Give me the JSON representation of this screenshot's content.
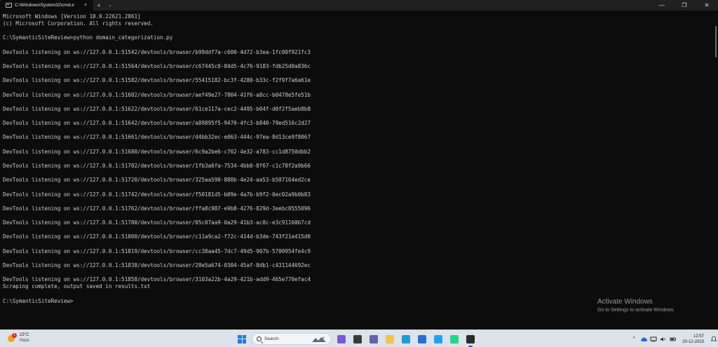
{
  "window": {
    "tab_title": "C:\\Windows\\System32\\cmd.e",
    "tab_close": "×",
    "new_tab": "+",
    "tab_menu": "⌄",
    "minimize": "—",
    "maximize": "❐",
    "close": "✕"
  },
  "console": {
    "lines": [
      "Microsoft Windows [Version 10.0.22621.2861]",
      "(c) Microsoft Corporation. All rights reserved.",
      "",
      "C:\\SymanticSiteReview>python domain_categorization.py",
      "",
      "DevTools listening on ws://127.0.0.1:51542/devtools/browser/b99ddf7a-c600-4d72-b3ea-1fc00f921fc3",
      "",
      "DevTools listening on ws://127.0.0.1:51564/devtools/browser/c67445c0-84d5-4c76-9183-fdb25d0a836c",
      "",
      "DevTools listening on ws://127.0.0.1:51582/devtools/browser/55415182-bc3f-4280-b33c-f2f9f7a6a61e",
      "",
      "DevTools listening on ws://127.0.0.1:51602/devtools/browser/aef49e27-7804-41f6-a8cc-b0478e5fe51b",
      "",
      "DevTools listening on ws://127.0.0.1:51622/devtools/browser/61ce117a-cec2-4495-b04f-d0f2f5aeb8b8",
      "",
      "DevTools listening on ws://127.0.0.1:51642/devtools/browser/a89895f5-9470-4fc3-b840-79ed516c2d27",
      "",
      "DevTools listening on ws://127.0.0.1:51661/devtools/browser/d4bb32ec-e063-444c-97ea-8d13ce9f8067",
      "",
      "DevTools listening on ws://127.0.0.1:51680/devtools/browser/6c9a2be6-c702-4e32-a783-cc1d8750dbb2",
      "",
      "DevTools listening on ws://127.0.0.1:51702/devtools/browser/1fb3a6fa-7534-4bb0-8f67-c1c78f2a9b66",
      "",
      "DevTools listening on ws://127.0.0.1:51720/devtools/browser/325aa590-880b-4e24-aa53-b507164ed2ce",
      "",
      "DevTools listening on ws://127.0.0.1:51742/devtools/browser/f50181d5-b09e-4a7b-b9f2-0ec02a9b0b83",
      "",
      "DevTools listening on ws://127.0.0.1:51762/devtools/browser/ffa8c987-e9b8-4276-829d-3eebc0555096",
      "",
      "DevTools listening on ws://127.0.0.1:51780/devtools/browser/05c07aa9-0a29-41b3-ac8c-e3c91160b7cd",
      "",
      "DevTools listening on ws://127.0.0.1:51800/devtools/browser/c11a9ca2-f72c-414d-b3de-743f21e415d0",
      "",
      "DevTools listening on ws://127.0.0.1:51819/devtools/browser/cc38aa45-7dc7-49d5-907b-5700954fe4c9",
      "",
      "DevTools listening on ws://127.0.0.1:51838/devtools/browser/28e5a674-0304-45af-8db1-c431144692ec",
      "",
      "DevTools listening on ws://127.0.0.1:51858/devtools/browser/3103a22b-4a29-421b-add9-465e770efac4",
      "Scraping complete, output saved in results.txt",
      "",
      "C:\\SymanticSiteReview>"
    ]
  },
  "watermark": {
    "title": "Activate Windows",
    "subtitle": "Go to Settings to activate Windows."
  },
  "taskbar": {
    "weather": {
      "temp": "23°C",
      "condition": "Haze",
      "badge": "1"
    },
    "search_label": "Search",
    "apps": [
      {
        "name": "copilot-icon",
        "color": "#7b5cd6"
      },
      {
        "name": "task-view-icon",
        "color": "#3a3a3a"
      },
      {
        "name": "teams-chat-icon",
        "color": "#6264a7"
      },
      {
        "name": "file-explorer-icon",
        "color": "#f2c34a"
      },
      {
        "name": "edge-icon",
        "color": "#1c9bd8"
      },
      {
        "name": "microsoft-store-icon",
        "color": "#2b6fd6"
      },
      {
        "name": "vscode-icon",
        "color": "#23a1f0"
      },
      {
        "name": "pycharm-icon",
        "color": "#21d789"
      },
      {
        "name": "terminal-icon",
        "color": "#2b2b2b"
      }
    ],
    "tray": {
      "chevron": "^",
      "clock_time": "12:57",
      "clock_date": "20-12-2023"
    }
  }
}
